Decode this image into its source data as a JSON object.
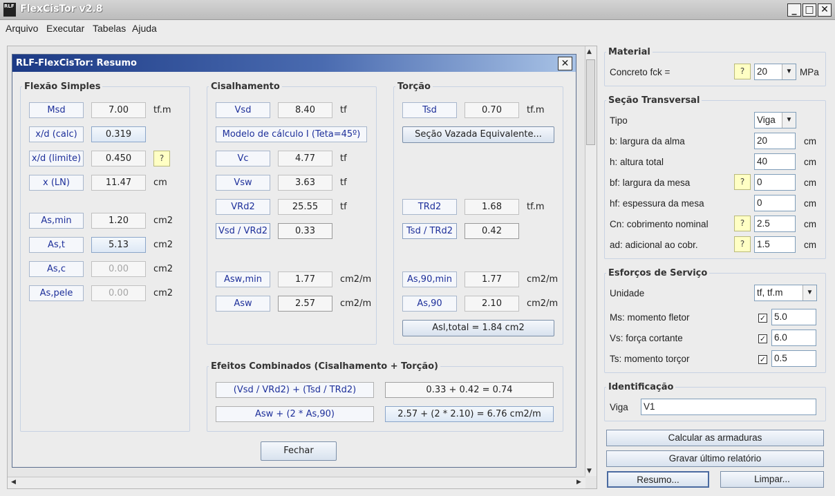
{
  "window": {
    "title": "FlexCisTor  v2.8",
    "icon_text": "RLF",
    "min": "_",
    "max": "□",
    "close": "✕"
  },
  "menu": [
    "Arquivo",
    "Executar",
    "Tabelas",
    "Ajuda"
  ],
  "dialog": {
    "title": "RLF-FlexCisTor:  Resumo",
    "close": "✕",
    "flexao": {
      "title": "Flexão Simples",
      "rows": [
        {
          "label": "Msd",
          "value": "7.00",
          "unit": "tf.m"
        },
        {
          "label": "x/d (calc)",
          "value": "0.319",
          "unit": ""
        },
        {
          "label": "x/d (limite)",
          "value": "0.450",
          "unit": ""
        },
        {
          "label": "x (LN)",
          "value": "11.47",
          "unit": "cm"
        },
        {
          "label": "As,min",
          "value": "1.20",
          "unit": "cm2"
        },
        {
          "label": "As,t",
          "value": "5.13",
          "unit": "cm2"
        },
        {
          "label": "As,c",
          "value": "0.00",
          "unit": "cm2"
        },
        {
          "label": "As,pele",
          "value": "0.00",
          "unit": "cm2"
        }
      ],
      "help": "?"
    },
    "cisalhamento": {
      "title": "Cisalhamento",
      "vsd": {
        "label": "Vsd",
        "value": "8.40",
        "unit": "tf"
      },
      "modelo": "Modelo de cálculo I  (Teta=45º)",
      "vc": {
        "label": "Vc",
        "value": "4.77",
        "unit": "tf"
      },
      "vsw": {
        "label": "Vsw",
        "value": "3.63",
        "unit": "tf"
      },
      "vrd2": {
        "label": "VRd2",
        "value": "25.55",
        "unit": "tf"
      },
      "ratio": {
        "label": "Vsd / VRd2",
        "value": "0.33"
      },
      "aswmin": {
        "label": "Asw,min",
        "value": "1.77",
        "unit": "cm2/m"
      },
      "asw": {
        "label": "Asw",
        "value": "2.57",
        "unit": "cm2/m"
      }
    },
    "torcao": {
      "title": "Torção",
      "tsd": {
        "label": "Tsd",
        "value": "0.70",
        "unit": "tf.m"
      },
      "secao": "Seção Vazada Equivalente...",
      "trd2": {
        "label": "TRd2",
        "value": "1.68",
        "unit": "tf.m"
      },
      "ratio": {
        "label": "Tsd / TRd2",
        "value": "0.42"
      },
      "as90min": {
        "label": "As,90,min",
        "value": "1.77",
        "unit": "cm2/m"
      },
      "as90": {
        "label": "As,90",
        "value": "2.10",
        "unit": "cm2/m"
      },
      "asl": "Asl,total = 1.84 cm2"
    },
    "efeitos": {
      "title": "Efeitos Combinados  (Cisalhamento + Torção)",
      "r1_label": "(Vsd / VRd2)  +  (Tsd / TRd2)",
      "r1_value": "0.33 + 0.42 = 0.74",
      "r2_label": "Asw  +  (2 * As,90)",
      "r2_value": "2.57 + (2 * 2.10) = 6.76 cm2/m"
    },
    "fechar": "Fechar"
  },
  "right": {
    "material": {
      "title": "Material",
      "label": "Concreto  fck =",
      "help": "?",
      "value": "20",
      "unit": "MPa"
    },
    "secao": {
      "title": "Seção Transversal",
      "tipo_label": "Tipo",
      "tipo_value": "Viga",
      "rows": [
        {
          "label": "b:  largura da alma",
          "value": "20",
          "unit": "cm",
          "help": false
        },
        {
          "label": "h:  altura total",
          "value": "40",
          "unit": "cm",
          "help": false
        },
        {
          "label": "bf:  largura da mesa",
          "value": "0",
          "unit": "cm",
          "help": true
        },
        {
          "label": "hf:  espessura da mesa",
          "value": "0",
          "unit": "cm",
          "help": false
        },
        {
          "label": "Cn:  cobrimento nominal",
          "value": "2.5",
          "unit": "cm",
          "help": true
        },
        {
          "label": "ad:  adicional ao cobr.",
          "value": "1.5",
          "unit": "cm",
          "help": true
        }
      ],
      "help": "?"
    },
    "esforcos": {
      "title": "Esforços de Serviço",
      "unidade_label": "Unidade",
      "unidade_value": "tf, tf.m",
      "rows": [
        {
          "label": "Ms: momento fletor",
          "value": "5.0"
        },
        {
          "label": "Vs: força cortante",
          "value": "6.0"
        },
        {
          "label": "Ts: momento torçor",
          "value": "0.5"
        }
      ],
      "check": "✓"
    },
    "identificacao": {
      "title": "Identificação",
      "label": "Viga",
      "value": "V1"
    },
    "buttons": {
      "calcular": "Calcular as armaduras",
      "gravar": "Gravar último relatório",
      "resumo": "Resumo...",
      "limpar": "Limpar..."
    }
  }
}
